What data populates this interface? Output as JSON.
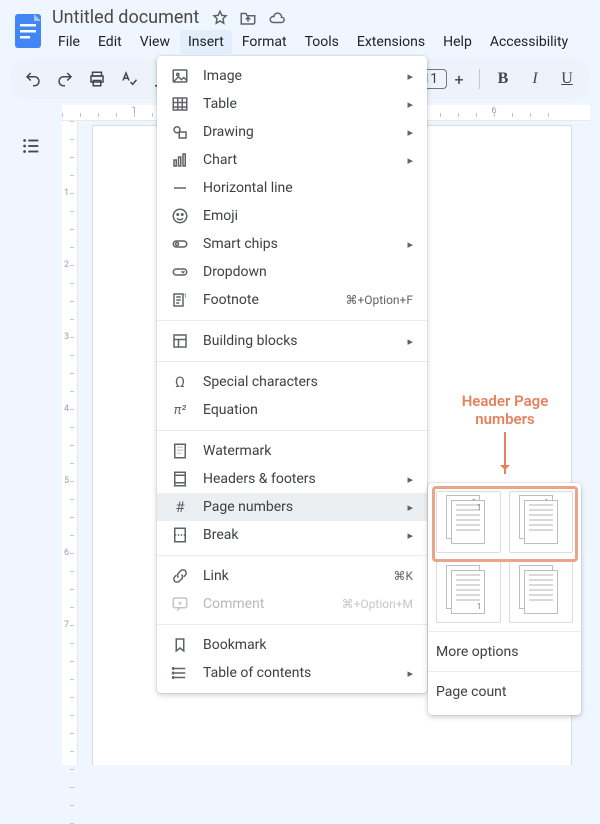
{
  "doc": {
    "title": "Untitled document"
  },
  "menus": {
    "file": "File",
    "edit": "Edit",
    "view": "View",
    "insert": "Insert",
    "format": "Format",
    "tools": "Tools",
    "extensions": "Extensions",
    "help": "Help",
    "accessibility": "Accessibility"
  },
  "toolbar": {
    "font_size": "11"
  },
  "insert_menu": {
    "image": "Image",
    "table": "Table",
    "drawing": "Drawing",
    "chart": "Chart",
    "hr": "Horizontal line",
    "emoji": "Emoji",
    "smart_chips": "Smart chips",
    "dropdown": "Dropdown",
    "footnote": "Footnote",
    "footnote_sc": "⌘+Option+F",
    "building_blocks": "Building blocks",
    "special_chars": "Special characters",
    "equation": "Equation",
    "watermark": "Watermark",
    "headers_footers": "Headers & footers",
    "page_numbers": "Page numbers",
    "break": "Break",
    "link": "Link",
    "link_sc": "⌘K",
    "comment": "Comment",
    "comment_sc": "⌘+Option+M",
    "bookmark": "Bookmark",
    "toc": "Table of contents"
  },
  "page_numbers_menu": {
    "more_options": "More options",
    "page_count": "Page count"
  },
  "annotation": {
    "label": "Header Page numbers"
  }
}
